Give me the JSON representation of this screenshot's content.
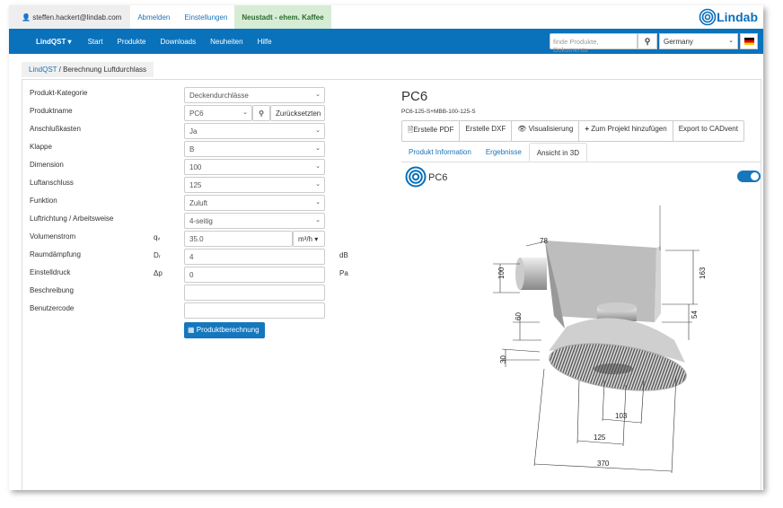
{
  "topbar": {
    "user": "steffen.hackert@lindab.com",
    "logout": "Abmelden",
    "settings": "Einstellungen",
    "location": "Neustadt - ehem. Kaffee",
    "logo": "Lindab"
  },
  "nav": {
    "brand": "LindQST ▾",
    "items": [
      "Start",
      "Produkte",
      "Downloads",
      "Neuheiten",
      "Hilfe"
    ],
    "search_placeholder": "finde Produkte, Dokumenta",
    "country": "Germany"
  },
  "breadcrumb": {
    "root": "LindQST",
    "current": " / Berechnung Luftdurchlass"
  },
  "form": {
    "rows": [
      {
        "label": "Produkt-Kategorie",
        "value": "Deckendurchlässe"
      },
      {
        "label": "Produktname",
        "value": "PC6",
        "reset": "Zurücksetzten"
      },
      {
        "label": "Anschlußkasten",
        "value": "Ja"
      },
      {
        "label": "Klappe",
        "value": "B"
      },
      {
        "label": "Dimension",
        "value": "100"
      },
      {
        "label": "Luftanschluss",
        "value": "125"
      },
      {
        "label": "Funktion",
        "value": "Zuluft"
      },
      {
        "label": "Luftrichtung / Arbeitsweise",
        "value": "4-seitig"
      },
      {
        "label": "Volumenstrom",
        "symbol": "qᵥ",
        "value": "35.0",
        "unit": "m³/h ▾"
      },
      {
        "label": "Raumdämpfung",
        "symbol": "Dᵣ",
        "value": "4",
        "unit": "dB"
      },
      {
        "label": "Einstelldruck",
        "symbol": "Δp",
        "value": "0",
        "unit": "Pa"
      },
      {
        "label": "Beschreibung",
        "value": ""
      },
      {
        "label": "Benutzercode",
        "value": ""
      }
    ],
    "calc_button": "Produktberechnung"
  },
  "product": {
    "title": "PC6",
    "code": "PC6-125-S+MBB-100-125-S",
    "actions": [
      "Erstelle PDF",
      "Erstelle DXF",
      "Visualisierung",
      "Zum Projekt hinzufügen",
      "Export to CADvent"
    ],
    "tabs": [
      "Produkt Information",
      "Ergebnisse",
      "Ansicht in 3D"
    ],
    "active_tab": "Ansicht in 3D",
    "view_title": "PC6",
    "toggle_on": true,
    "dimensions": [
      "78",
      "100",
      "163",
      "54",
      "60",
      "30",
      "103",
      "125",
      "370"
    ]
  },
  "colors": {
    "primary": "#0a72bb",
    "location_bg": "#d6ecd4"
  }
}
